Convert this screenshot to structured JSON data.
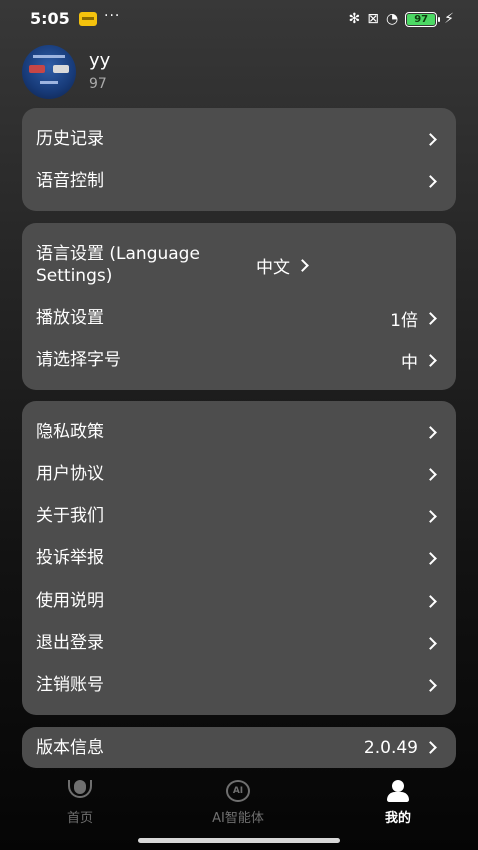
{
  "status_bar": {
    "time": "5:05",
    "dots": "···",
    "bluetooth_icon": "✻",
    "sim_icon": "⊠",
    "wifi_icon": "◔",
    "battery_level": "97",
    "charging_icon": "⚡"
  },
  "profile": {
    "name": "yy",
    "id": "97"
  },
  "group1": {
    "history": "历史记录",
    "voice": "语音控制"
  },
  "group2": {
    "language_label": "语言设置 (Language Settings)",
    "language_value": "中文",
    "playback_label": "播放设置",
    "playback_value": "1倍",
    "fontsize_label": "请选择字号",
    "fontsize_value": "中"
  },
  "group3": {
    "privacy": "隐私政策",
    "agreement": "用户协议",
    "about": "关于我们",
    "report": "投诉举报",
    "manual": "使用说明",
    "logout": "退出登录",
    "delete_account": "注销账号"
  },
  "version": {
    "label": "版本信息",
    "value": "2.0.49"
  },
  "bottom_nav": {
    "home": "首页",
    "ai": "AI智能体",
    "ai_icon_text": "AI",
    "me": "我的"
  },
  "colors": {
    "card_bg": "#4d4d4d",
    "inactive_nav": "#6f6f6f",
    "battery": "#4cd964"
  }
}
